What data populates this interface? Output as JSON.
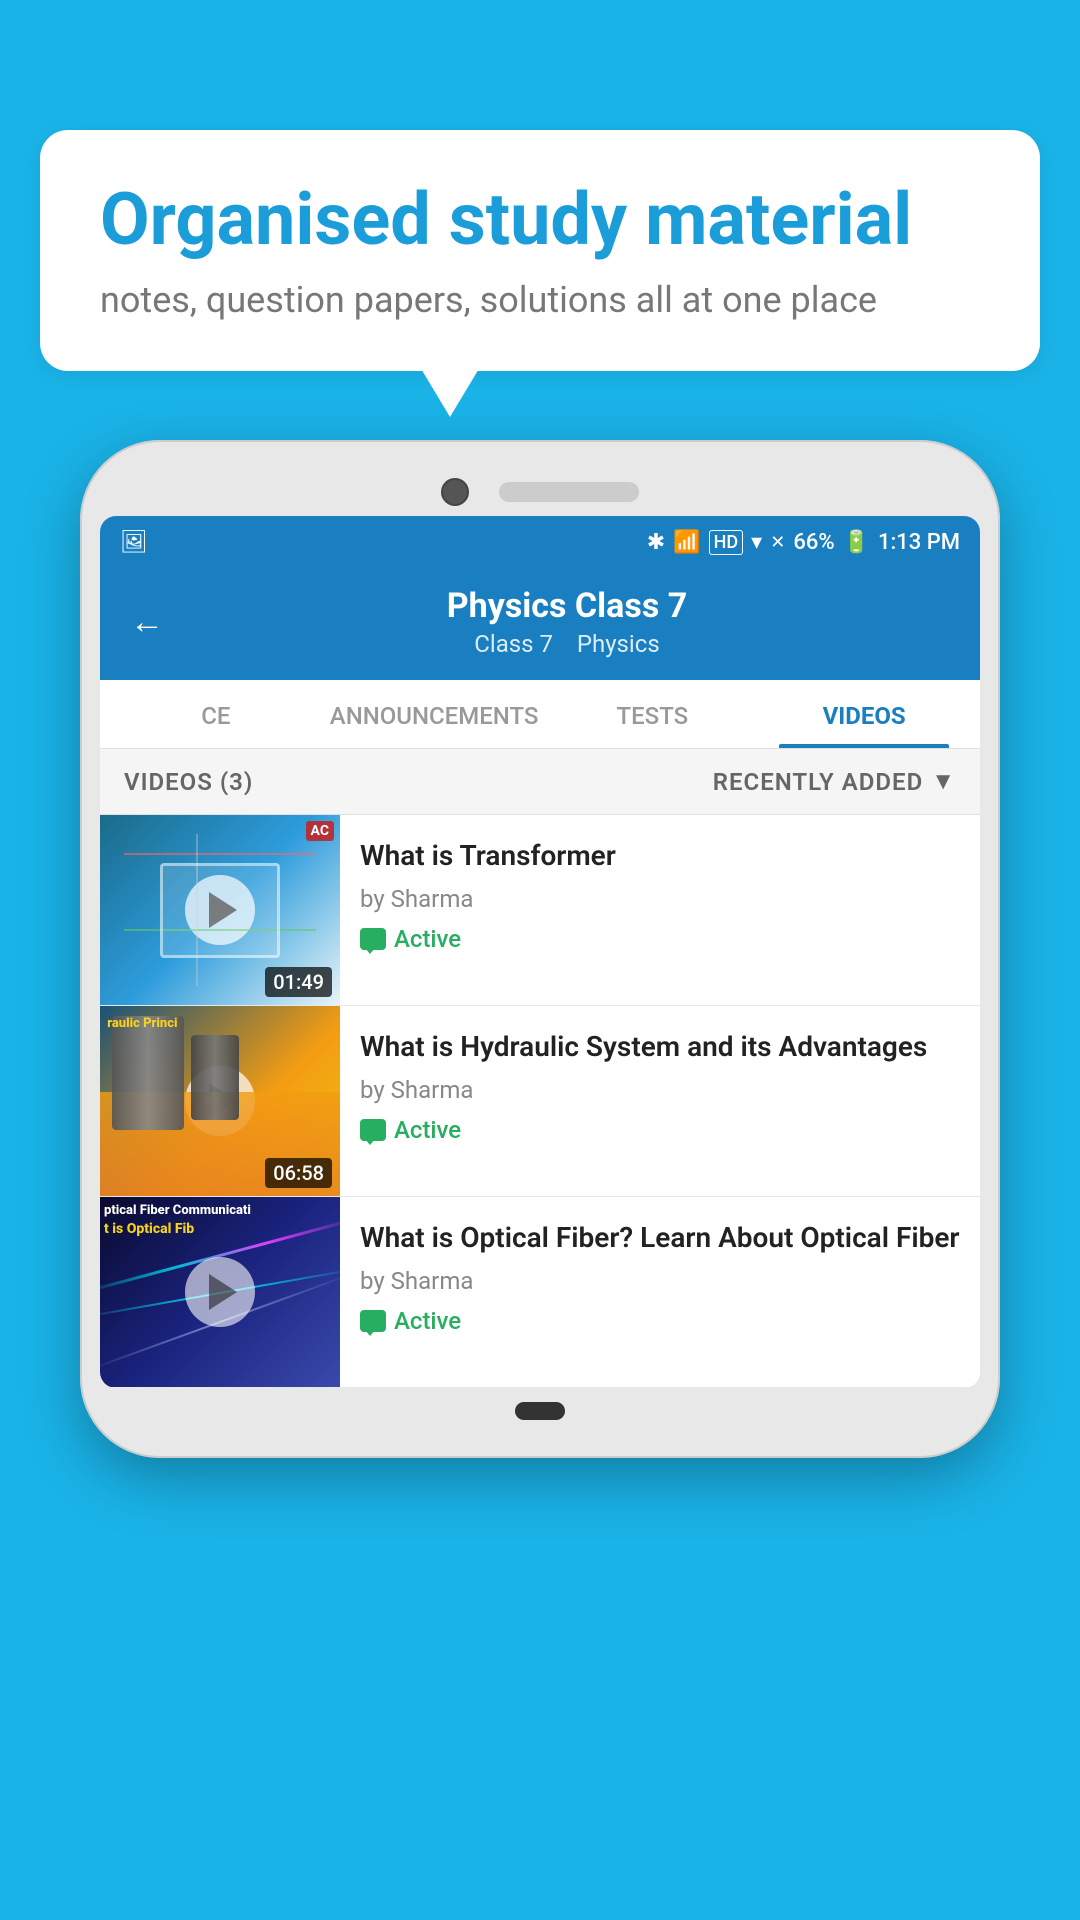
{
  "background_color": "#1ab3e8",
  "speech_bubble": {
    "title": "Organised study material",
    "subtitle": "notes, question papers, solutions all at one place"
  },
  "phone": {
    "status_bar": {
      "time": "1:13 PM",
      "battery": "66%",
      "signal_icons": "▲▲ ✕"
    },
    "header": {
      "back_label": "←",
      "title": "Physics Class 7",
      "subtitle_class": "Class 7",
      "subtitle_subject": "Physics"
    },
    "tabs": [
      {
        "label": "CE",
        "active": false
      },
      {
        "label": "ANNOUNCEMENTS",
        "active": false
      },
      {
        "label": "TESTS",
        "active": false
      },
      {
        "label": "VIDEOS",
        "active": true
      }
    ],
    "videos_header": {
      "count_label": "VIDEOS (3)",
      "sort_label": "RECENTLY ADDED",
      "sort_icon": "▼"
    },
    "videos": [
      {
        "title": "What is  Transformer",
        "author": "by Sharma",
        "status": "Active",
        "duration": "01:49",
        "thumb_type": "transformer"
      },
      {
        "title": "What is Hydraulic System and its Advantages",
        "author": "by Sharma",
        "status": "Active",
        "duration": "06:58",
        "thumb_type": "hydraulic"
      },
      {
        "title": "What is Optical Fiber? Learn About Optical Fiber",
        "author": "by Sharma",
        "status": "Active",
        "duration": "",
        "thumb_type": "fiber"
      }
    ]
  }
}
